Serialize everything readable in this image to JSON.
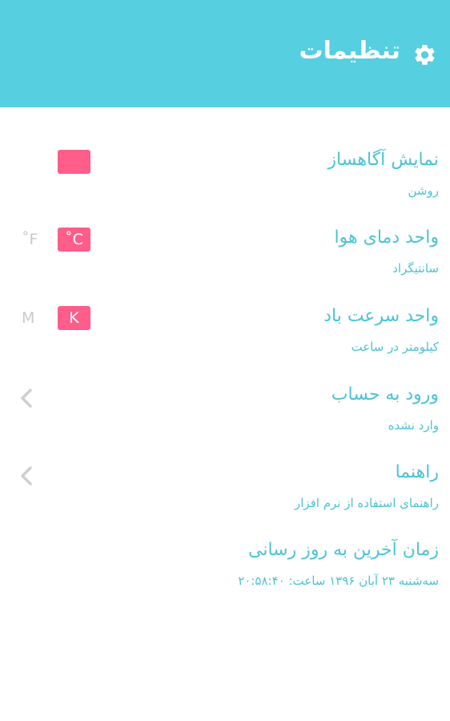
{
  "header": {
    "title": "تنظیمات",
    "icon": "gear-icon",
    "background": "#56cfe0"
  },
  "accent_color": "#4cc3d5",
  "toggle_color": "#ff5d8a",
  "settings": {
    "notification": {
      "title": "نمایش آگاهساز",
      "subtitle": "روشن",
      "toggle_label": ""
    },
    "temperature": {
      "title": "واحد دمای هوا",
      "subtitle": "سانتیگراد",
      "selected_unit": "˚C",
      "other_unit": "˚F"
    },
    "wind": {
      "title": "واحد سرعت باد",
      "subtitle": "کیلومتر در ساعت",
      "selected_unit": "K",
      "other_unit": "M"
    },
    "login": {
      "title": "ورود به حساب",
      "subtitle": "وارد نشده",
      "icon": "chevron-left-icon"
    },
    "help": {
      "title": "راهنما",
      "subtitle": "راهنمای استفاده از نرم افزار",
      "icon": "chevron-left-icon"
    },
    "last_update": {
      "title": "زمان آخرین به روز رسانی",
      "subtitle": "سه‌شنبه ۲۳ آبان ۱۳۹۶ ساعت: ۲۰:۵۸:۴۰"
    }
  }
}
